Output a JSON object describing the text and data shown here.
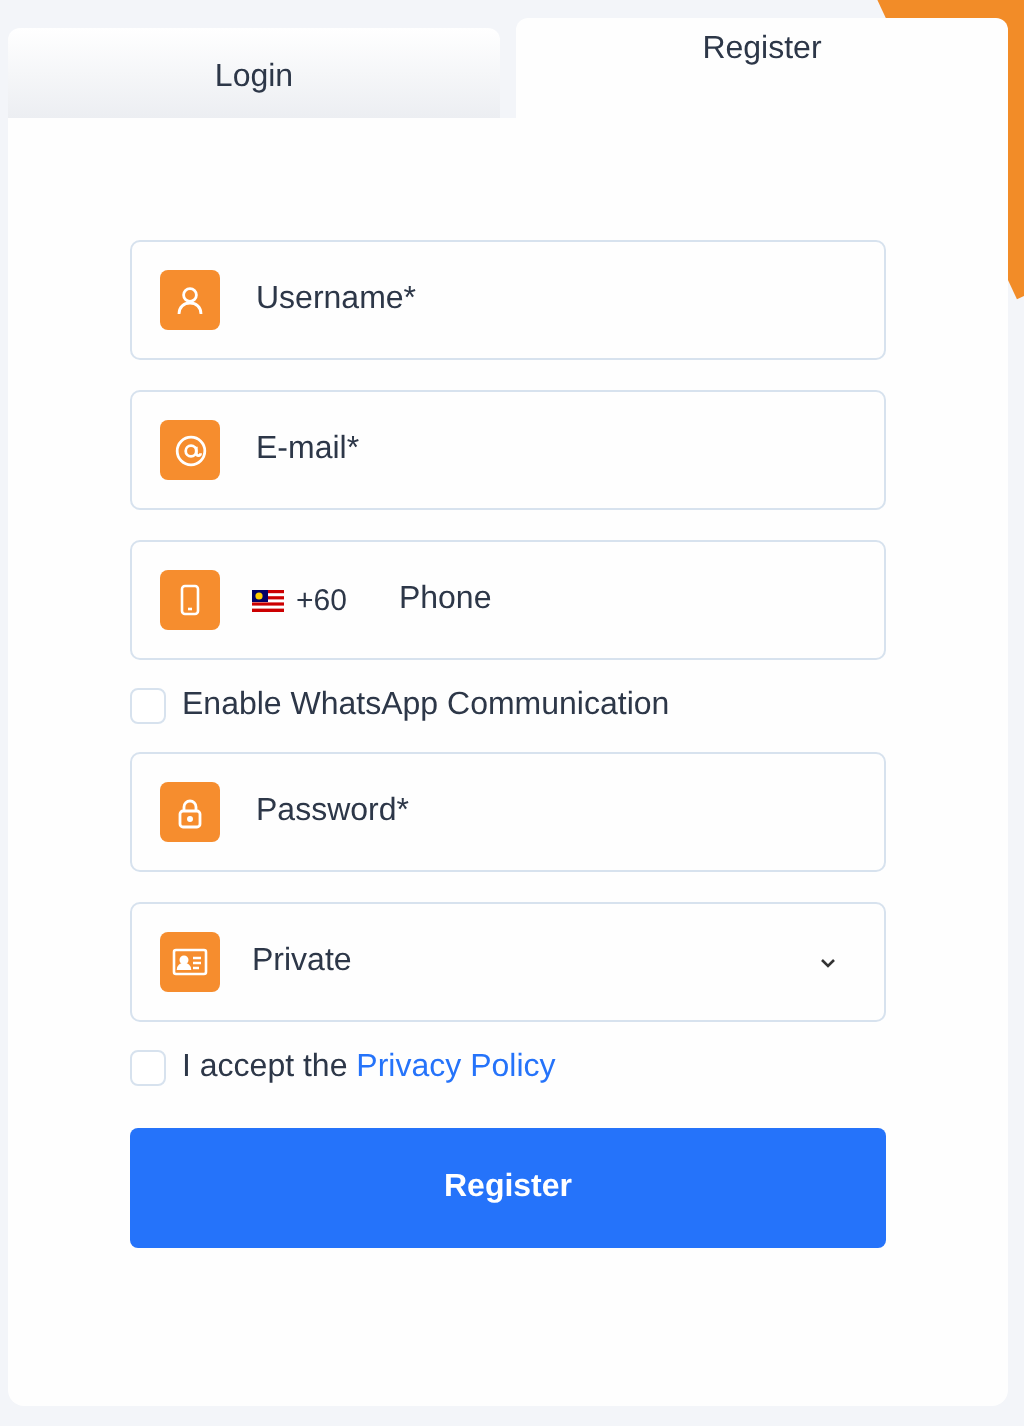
{
  "tabs": [
    {
      "label": "Login",
      "selected": false
    },
    {
      "label": "Register",
      "selected": true
    }
  ],
  "form": {
    "items": [
      {
        "kind": "username",
        "placeholder": "Username*"
      },
      {
        "kind": "email",
        "placeholder": "E-mail*"
      },
      {
        "kind": "phone",
        "country_code": "+60",
        "placeholder": "Phone"
      },
      {
        "kind": "checkbox",
        "label": "Enable WhatsApp Communication",
        "checked": false
      },
      {
        "kind": "password",
        "placeholder": "Password*"
      },
      {
        "kind": "select",
        "value": "Private"
      },
      {
        "kind": "consent",
        "text": "I accept the",
        "link": "Privacy Policy",
        "checked": false
      }
    ],
    "submit": "Register"
  }
}
